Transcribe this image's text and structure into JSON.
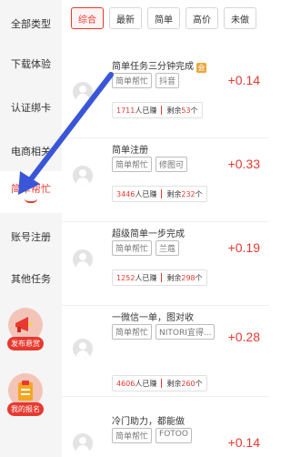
{
  "sidebar": {
    "items": [
      {
        "label": "全部类型"
      },
      {
        "label": "下载体验"
      },
      {
        "label": "认证绑卡"
      },
      {
        "label": "电商相关"
      },
      {
        "label": "简单帮忙",
        "active": true
      },
      {
        "label": "账号注册"
      },
      {
        "label": "其他任务"
      }
    ],
    "publish_label": "发布悬赏",
    "my_signup_label": "我的报名"
  },
  "tabs": [
    {
      "label": "综合",
      "active": true
    },
    {
      "label": "最新"
    },
    {
      "label": "简单"
    },
    {
      "label": "高价"
    },
    {
      "label": "未做"
    }
  ],
  "tasks": [
    {
      "title": "简单任务三分钟完成",
      "tags": [
        "简单帮忙",
        "抖音"
      ],
      "earned": "1711",
      "earned_suffix": "人已赚",
      "remaining_prefix": "剩余",
      "remaining": "53",
      "remaining_suffix": "个",
      "reward": "+0.14",
      "badge": "会"
    },
    {
      "title": "简单注册",
      "tags": [
        "简单帮忙",
        "修图可"
      ],
      "earned": "3446",
      "earned_suffix": "人已赚",
      "remaining_prefix": "剩余",
      "remaining": "232",
      "remaining_suffix": "个",
      "reward": "+0.33"
    },
    {
      "title": "超级简单一步完成",
      "tags": [
        "简单帮忙",
        "兰蔻"
      ],
      "earned": "1252",
      "earned_suffix": "人已赚",
      "remaining_prefix": "剩余",
      "remaining": "298",
      "remaining_suffix": "个",
      "reward": "+0.19"
    },
    {
      "title": "一微信一单，图对收",
      "tags": [
        "简单帮忙",
        "NITORI宜得..."
      ],
      "earned": "4606",
      "earned_suffix": "人已赚",
      "remaining_prefix": "剩余",
      "remaining": "260",
      "remaining_suffix": "个",
      "reward": "+0.28"
    },
    {
      "title": "冷门助力，都能做",
      "tags": [
        "简单帮忙",
        "FOTOO"
      ],
      "reward": "+0.14"
    }
  ],
  "colors": {
    "accent": "#e8392f",
    "arrow": "#3a56d8",
    "badge": "#e9a63b"
  }
}
